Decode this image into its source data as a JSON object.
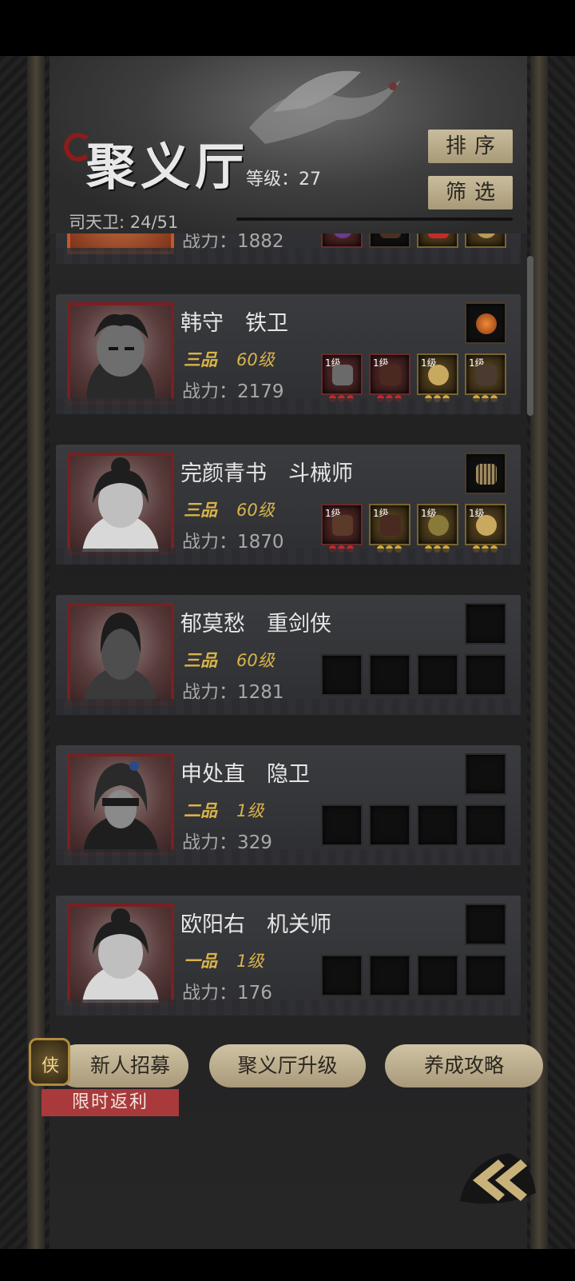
{
  "header": {
    "title": "聚义厅",
    "level_text": "等级：27",
    "guard_count": "司天卫: 24/51",
    "sort_label": "排序",
    "filter_label": "筛选"
  },
  "heroes": [
    {
      "name": "",
      "rank": "",
      "level": "",
      "power": "战力：1882",
      "slots": [
        "purple",
        "dark",
        "red",
        "gold"
      ]
    },
    {
      "name": "韩守　铁卫",
      "rank": "三品",
      "level": "60级",
      "power": "战力：2179",
      "accessory": "amber-gem",
      "slot_levels": [
        "1级",
        "1级",
        "1级",
        "1级"
      ]
    },
    {
      "name": "完颜青书　斗械师",
      "rank": "三品",
      "level": "60级",
      "power": "战力：1870",
      "accessory": "comb",
      "slot_levels": [
        "1级",
        "1级",
        "1级",
        "1级"
      ]
    },
    {
      "name": "郁莫愁　重剑侠",
      "rank": "三品",
      "level": "60级",
      "power": "战力：1281"
    },
    {
      "name": "申处直　隐卫",
      "rank": "二品",
      "level": "1级",
      "power": "战力：329"
    },
    {
      "name": "欧阳右　机关师",
      "rank": "一品",
      "level": "1级",
      "power": "战力：176"
    }
  ],
  "bottom": {
    "recruit_label": "新人招募",
    "recruit_icon_glyph": "侠",
    "promo_label": "限时返利",
    "upgrade_label": "聚义厅升级",
    "guide_label": "养成攻略"
  },
  "colors": {
    "rank_gold": "#d9b44a",
    "portrait_border": "#7a1f22",
    "button_beige": "#c9bc9c",
    "promo_red": "#a83a3c"
  }
}
